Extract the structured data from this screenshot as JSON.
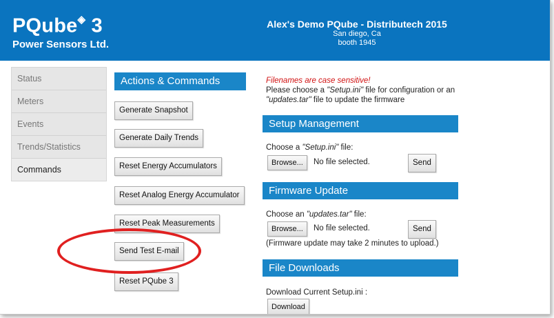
{
  "header": {
    "product": "PQube",
    "product_mark": "◈",
    "product_num": " 3",
    "company": "Power Sensors Ltd.",
    "device_name": "Alex's Demo PQube - Distributech 2015",
    "location": "San diego, Ca",
    "booth": "booth 1945"
  },
  "nav": {
    "items": [
      {
        "label": "Status"
      },
      {
        "label": "Meters"
      },
      {
        "label": "Events"
      },
      {
        "label": "Trends/Statistics"
      },
      {
        "label": "Commands",
        "active": true
      }
    ]
  },
  "actions": {
    "title": "Actions & Commands",
    "buttons": [
      "Generate Snapshot",
      "Generate Daily Trends",
      "Reset Energy Accumulators",
      "Reset Analog Energy Accumulator",
      "Reset Peak Measurements",
      "Send Test E-mail",
      "Reset PQube 3"
    ]
  },
  "info": {
    "warning": "Filenames are case sensitive!",
    "line1_a": "Please choose a ",
    "line1_b": "\"Setup.ini\"",
    "line1_c": " file for configuration or an",
    "line2_a": "\"updates.tar\"",
    "line2_b": " file to update the firmware"
  },
  "setup": {
    "title": "Setup Management",
    "choose_a": "Choose a ",
    "choose_b": "\"Setup.ini\"",
    "choose_c": " file:",
    "browse_label": "Browse...",
    "no_file": "No file selected.",
    "send_label": "Send"
  },
  "firmware": {
    "title": "Firmware Update",
    "choose_a": "Choose an ",
    "choose_b": "\"updates.tar\"",
    "choose_c": " file:",
    "browse_label": "Browse...",
    "no_file": "No file selected.",
    "send_label": "Send",
    "note": "(Firmware update may take 2 minutes to upload.)"
  },
  "downloads": {
    "title": "File Downloads",
    "label": "Download Current Setup.ini :",
    "button_label": "Download"
  },
  "colors": {
    "header_blue": "#0a74bf",
    "section_blue": "#1a86c8",
    "warning_red": "#d01010",
    "highlight_red": "#e02020"
  }
}
